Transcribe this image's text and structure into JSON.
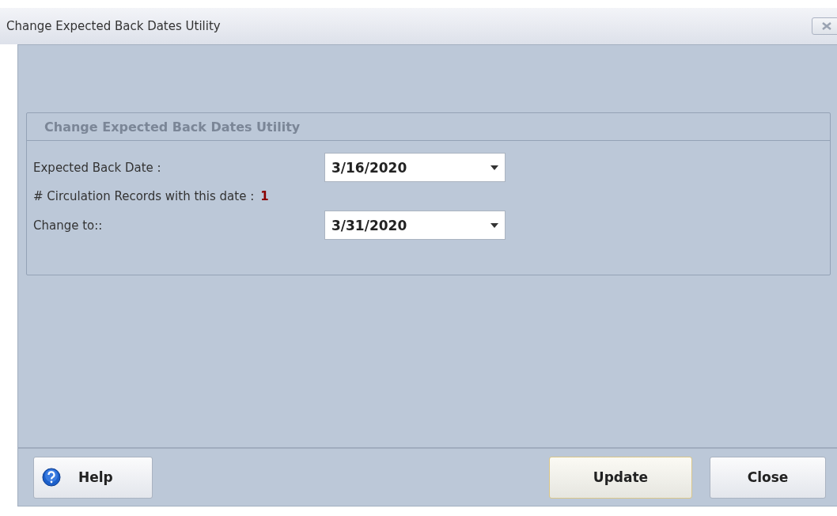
{
  "window": {
    "title": "Change Expected Back Dates Utility"
  },
  "group": {
    "title": "Change Expected Back Dates Utility",
    "rows": [
      {
        "kind": "date",
        "label": "Expected Back Date :",
        "value": "3/16/2020"
      },
      {
        "kind": "count",
        "label": "# Circulation Records with this date :",
        "value": "1"
      },
      {
        "kind": "date",
        "label": "Change to::",
        "value": "3/31/2020"
      }
    ]
  },
  "buttons": [
    {
      "label": "Help",
      "kind": "help",
      "focused": false
    },
    {
      "label": "Update",
      "kind": "plain",
      "focused": true
    },
    {
      "label": "Close",
      "kind": "plain",
      "focused": false
    }
  ]
}
